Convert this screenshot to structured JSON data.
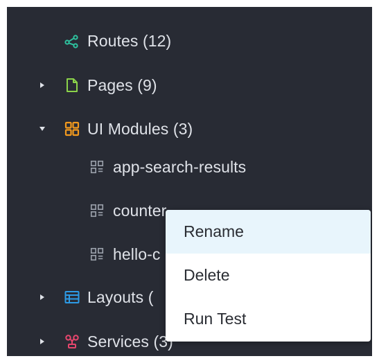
{
  "tree": {
    "routes": {
      "label": "Routes (12)",
      "icon": "routes-share-icon",
      "color": "#2ec4a0"
    },
    "pages": {
      "label": "Pages (9)",
      "icon": "page-file-icon",
      "color": "#8bd34a"
    },
    "ui_modules": {
      "label": "UI Modules (3)",
      "icon": "grid-modules-icon",
      "color": "#f39a1e",
      "children": [
        {
          "label": "app-search-results",
          "icon": "module-grid-icon"
        },
        {
          "label": "counter",
          "icon": "module-grid-icon"
        },
        {
          "label": "hello-c",
          "icon": "module-grid-icon"
        }
      ]
    },
    "layouts": {
      "label": "Layouts (",
      "icon": "layout-icon",
      "color": "#2d9be6"
    },
    "services": {
      "label": "Services (3)",
      "icon": "services-icon",
      "color": "#e5466d"
    }
  },
  "context_menu": {
    "items": [
      {
        "label": "Rename"
      },
      {
        "label": "Delete"
      },
      {
        "label": "Run Test"
      }
    ]
  },
  "colors": {
    "background": "#282b34",
    "text": "#dfe2e8",
    "menu_background": "#ffffff",
    "menu_hover": "#e8f5fc"
  }
}
